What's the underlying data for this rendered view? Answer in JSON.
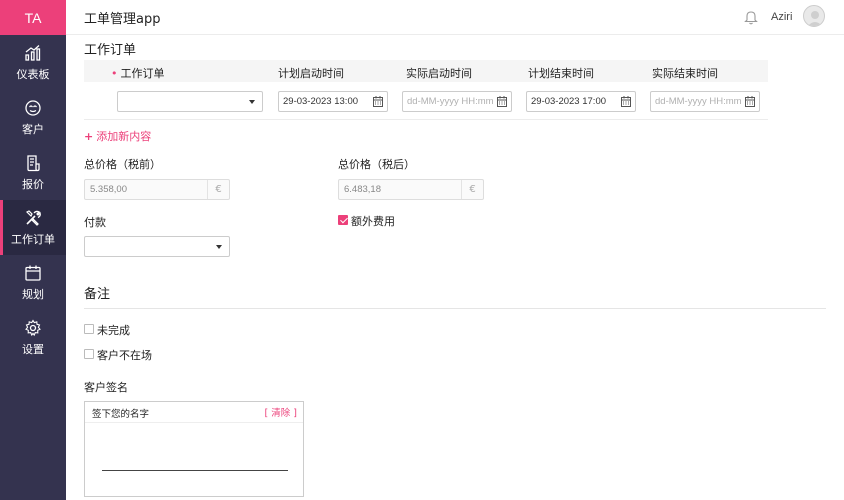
{
  "brand": "TA",
  "app_title": "工单管理app",
  "user": {
    "name": "Aziri"
  },
  "nav": [
    {
      "label": "仪表板",
      "icon": "dashboard-icon"
    },
    {
      "label": "客户",
      "icon": "customer-icon"
    },
    {
      "label": "报价",
      "icon": "quote-icon"
    },
    {
      "label": "工作订单",
      "icon": "tools-icon",
      "active": true
    },
    {
      "label": "规划",
      "icon": "calendar-icon"
    },
    {
      "label": "设置",
      "icon": "gear-icon"
    }
  ],
  "work_order": {
    "section_title": "工作订单",
    "columns": [
      "工作订单",
      "计划启动时间",
      "实际启动时间",
      "计划结束时间",
      "实际结束时间"
    ],
    "row": {
      "order": "",
      "planned_start": "29-03-2023 13:00",
      "actual_start_placeholder": "dd-MM-yyyy HH:mm",
      "planned_end": "29-03-2023 17:00",
      "actual_end_placeholder": "dd-MM-yyyy HH:mm"
    },
    "add_label": "添加新内容"
  },
  "pricing": {
    "pre_tax_label": "总价格（税前）",
    "pre_tax_value": "5.358,00",
    "post_tax_label": "总价格（税后）",
    "post_tax_value": "6.483,18",
    "currency": "€"
  },
  "payment": {
    "label": "付款",
    "value": ""
  },
  "extra_cost": {
    "label": "额外费用",
    "checked": true
  },
  "notes": {
    "section_title": "备注",
    "options": [
      {
        "label": "未完成",
        "checked": false
      },
      {
        "label": "客户不在场",
        "checked": false
      }
    ]
  },
  "signature": {
    "label": "客户签名",
    "hint": "签下您的名字",
    "clear": "[ 清除 ]"
  },
  "colors": {
    "accent": "#ec407a",
    "sidebar": "#34334f"
  }
}
